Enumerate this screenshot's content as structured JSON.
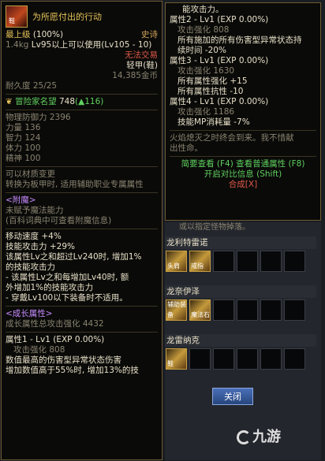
{
  "left": {
    "title": "为所愿付出的行动",
    "icon_label": "鞋",
    "grade": "最上级",
    "grade_pct": "(100%)",
    "rarity": "史诗",
    "weight": "1.4kg",
    "level_req": "Lv95以上可以使用(Lv105 - 10)",
    "trade": "无法交易",
    "type": "轻甲(鞋)",
    "price": "14,385金币",
    "durability": "耐久度 25/25",
    "adv_label": "冒险家名望",
    "adv_value": "748",
    "adv_up": "(▲116)",
    "stats": [
      "物理防御力 2396",
      "力量 136",
      "智力 124",
      "体力 100",
      "精神 100"
    ],
    "notes": [
      "可以材质变更",
      "转换为板甲时, 适用辅助职业专属属性"
    ],
    "enchant_header": "<附魔>",
    "enchant_lines": [
      "未赋予魔法能力",
      "(百科词典中可查看附魔信息)"
    ],
    "effects": [
      "移动速度 +4%",
      "技能攻击力 +29%",
      "该属性Lv之和超过Lv240时, 增加1%",
      "的技能攻击力",
      "- 该属性Lv之和每增加Lv40时, 额",
      "外增加1%的技能攻击力",
      "- 穿戴Lv100以下装备时不适用。"
    ],
    "growth_header": "<成长属性>",
    "growth_total": "成长属性总攻击强化 4432",
    "attr1_title": "属性1 - Lv1 (EXP 0.00%)",
    "attr1_lines": [
      "攻击强化 808",
      "数值最高的伤害型异常状态伤害",
      "增加数值高于55%时, 增加13%的技"
    ]
  },
  "right": {
    "top_line": "能攻击力。",
    "attr2_title": "属性2 - Lv1 (EXP 0.00%)",
    "attr2_lines": [
      "攻击强化 808",
      "所有施加的所有伤害型异常状态持",
      "续时间 -20%"
    ],
    "attr3_title": "属性3 - Lv1 (EXP 0.00%)",
    "attr3_lines": [
      "攻击强化 1630",
      "所有属性强化 +15",
      "所有属性抗性 -10"
    ],
    "attr4_title": "属性4 - Lv1 (EXP 0.00%)",
    "attr4_lines": [
      "攻击强化 1186",
      "技能MP消耗量 -7%"
    ],
    "flavor": [
      "火焰熄灭之时终会到来。我不惜献",
      "出性命。"
    ],
    "hint1": "简要查看 (F4) 查看普通属性 (F8)",
    "hint2": "开启对比信息 (Shift)",
    "hint3": "合成[X]",
    "cut_text": "或以指定怪物掉落。"
  },
  "sets": [
    {
      "label": "龙利特雷诺",
      "slots": [
        "头肩",
        "戒指",
        "",
        "",
        "",
        "",
        ""
      ]
    },
    {
      "label": "龙奈伊泽",
      "slots": [
        "辅助装备",
        "魔法石",
        "",
        "",
        "",
        "",
        ""
      ]
    },
    {
      "label": "龙雷纳克",
      "slots": [
        "鞋",
        "",
        "",
        "",
        "",
        "",
        ""
      ]
    }
  ],
  "close_label": "关闭",
  "watermark": "九游"
}
